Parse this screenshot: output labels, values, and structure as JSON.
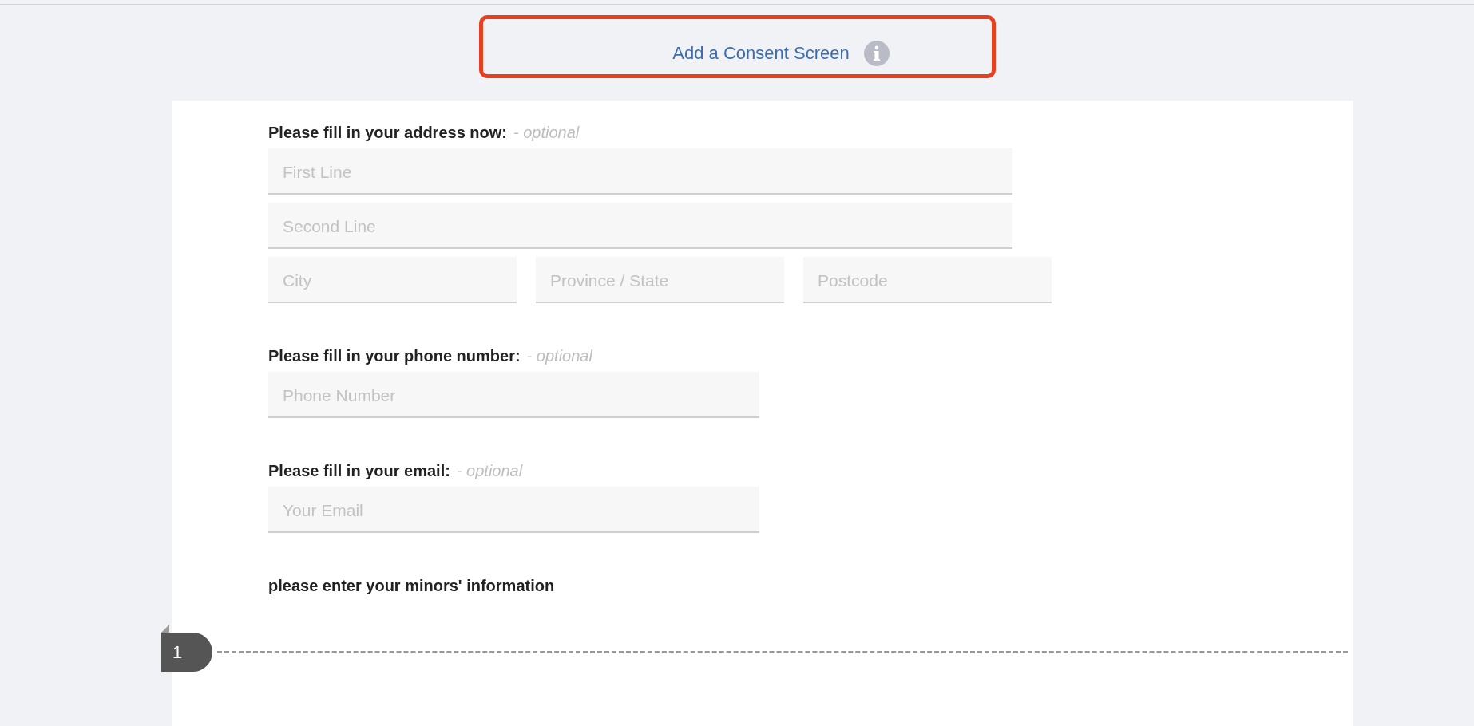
{
  "consent_link": {
    "label": "Add a Consent Screen"
  },
  "sections": [
    {
      "kind": "address",
      "label": "Please fill in your address now:",
      "note": "- optional",
      "rows": [
        {
          "fields": [
            {
              "placeholder": "First Line"
            }
          ]
        },
        {
          "fields": [
            {
              "placeholder": "Second Line"
            }
          ]
        },
        {
          "fields": [
            {
              "placeholder": "City"
            },
            {
              "placeholder": "Province / State"
            },
            {
              "placeholder": "Postcode"
            }
          ]
        }
      ]
    },
    {
      "kind": "phone",
      "label": "Please fill in your phone number:",
      "note": "- optional",
      "rows": [
        {
          "fields": [
            {
              "placeholder": "Phone Number"
            }
          ]
        }
      ]
    },
    {
      "kind": "email",
      "label": "Please fill in your email:",
      "note": "- optional",
      "rows": [
        {
          "fields": [
            {
              "placeholder": "Your Email"
            }
          ]
        }
      ]
    }
  ],
  "minors": {
    "heading": "please enter your minors' information",
    "items": [
      {
        "number": "1"
      }
    ]
  }
}
